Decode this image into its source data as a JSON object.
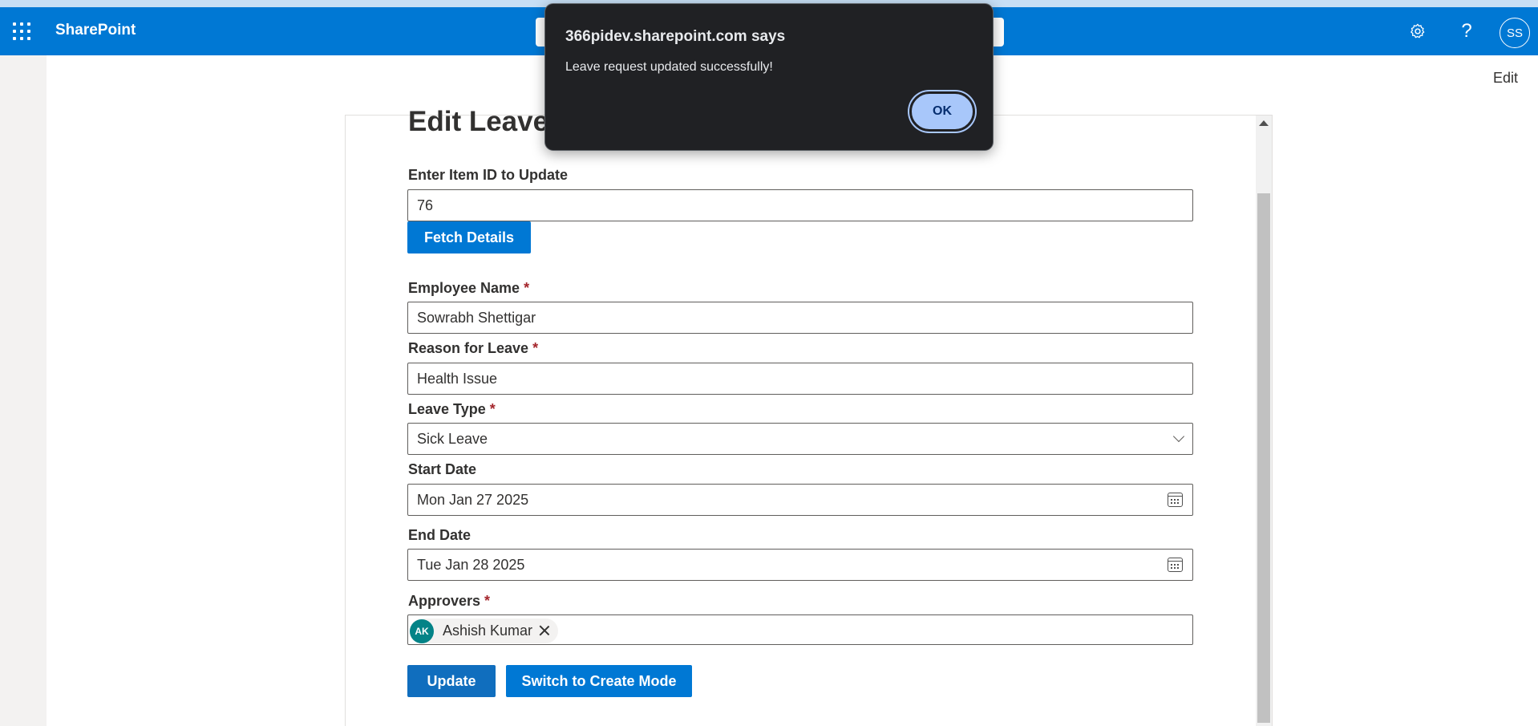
{
  "suite": {
    "brand": "SharePoint",
    "avatar_initials": "SS",
    "help_glyph": "?",
    "icons": [
      "app-launcher-icon",
      "gear-icon",
      "help-icon"
    ]
  },
  "page": {
    "edit_label": "Edit"
  },
  "form": {
    "title": "Edit Leave",
    "item_id_label": "Enter Item ID to Update",
    "item_id_value": "76",
    "fetch_label": "Fetch Details",
    "employee_label": "Employee Name",
    "employee_value": "Sowrabh Shettigar",
    "reason_label": "Reason for Leave",
    "reason_value": "Health Issue",
    "leave_type_label": "Leave Type",
    "leave_type_value": "Sick Leave",
    "start_label": "Start Date",
    "start_value": "Mon Jan 27 2025",
    "end_label": "End Date",
    "end_value": "Tue Jan 28 2025",
    "approvers_label": "Approvers",
    "approver": {
      "initials": "AK",
      "name": "Ashish Kumar",
      "color": "#038387"
    },
    "required_mark": "*",
    "update_label": "Update",
    "switch_label": "Switch to Create Mode"
  },
  "dialog": {
    "title": "366pidev.sharepoint.com says",
    "message": "Leave request updated successfully!",
    "ok_label": "OK"
  },
  "colors": {
    "accent": "#0078d4",
    "dialog_bg": "#202124",
    "ok_button": "#a8c7fa"
  }
}
